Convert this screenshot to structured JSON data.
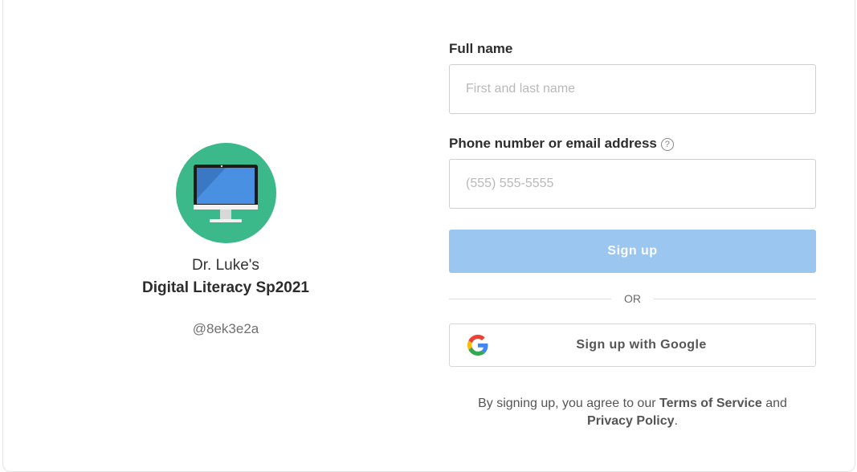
{
  "class_info": {
    "teacher": "Dr. Luke's",
    "class_name": "Digital Literacy Sp2021",
    "class_code": "@8ek3e2a",
    "avatar_icon": "desktop-computer-icon",
    "avatar_color": "#3cb98a"
  },
  "form": {
    "full_name": {
      "label": "Full name",
      "placeholder": "First and last name",
      "value": ""
    },
    "contact": {
      "label": "Phone number or email address",
      "help_icon": "question-circle-icon",
      "help_glyph": "?",
      "placeholder": "(555) 555-5555",
      "value": ""
    },
    "signup_button": "Sign up",
    "signup_button_color": "#9ac6f0",
    "or_text": "OR",
    "google_button": "Sign up with Google",
    "google_icon": "google-g-icon"
  },
  "terms": {
    "prefix": "By signing up, you agree to our ",
    "terms_link": "Terms of Service",
    "middle": " and",
    "privacy_link": "Privacy Policy",
    "suffix": "."
  }
}
